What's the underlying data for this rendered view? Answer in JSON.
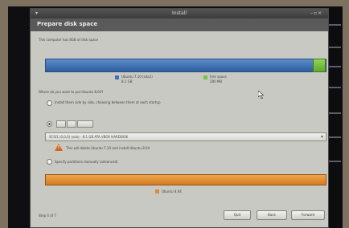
{
  "window": {
    "title": "Install",
    "header": "Prepare disk space"
  },
  "intro_text": "This computer has 8GB of disk space",
  "disk": {
    "legend_used_label": "Ubuntu 7.10 (sda1)",
    "legend_used_size": "8.1 GB",
    "legend_free_label": "free space",
    "legend_free_size": "280 MB",
    "used_color": "#3f72b5",
    "free_color": "#7bc142",
    "free_fraction": 0.04
  },
  "question": "Where do you want to put Ubuntu 8.04?",
  "option_use_free": "Install them side by side, choosing between them at each startup",
  "mini_buttons": [
    "",
    "",
    ""
  ],
  "partition_select_value": "SCSI1 (0,0,0) (sda) - 8.1 GB ATA VBOX HARDDISK",
  "warning_text": "This will delete Ubuntu 7.10 and install Ubuntu 8.04",
  "option_manual": "Specify partitions manually (advanced)",
  "partition": {
    "label": "Ubuntu 8.04",
    "color": "#e0883a"
  },
  "footer": {
    "step": "Step 4 of 7",
    "quit_label": "Quit",
    "back_label": "Back",
    "forward_label": "Forward"
  },
  "icons": {
    "warning": "warning-icon",
    "cursor": "mouse-cursor-icon"
  }
}
